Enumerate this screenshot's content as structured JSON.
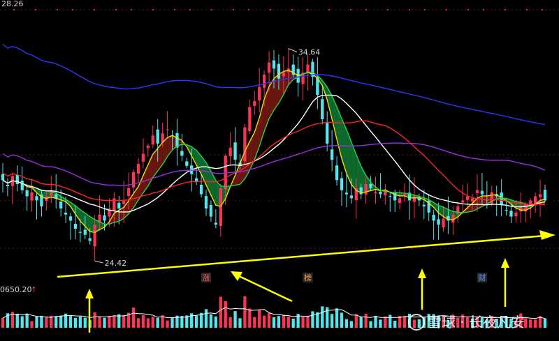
{
  "chart_data": {
    "type": "candlestick",
    "price_axis_top_label": "28.26",
    "price_range": [
      23.0,
      36.0
    ],
    "high_marker": {
      "value": "34.64",
      "index": 54
    },
    "low_marker": {
      "value": "24.42",
      "index": 18
    },
    "volume_label": "0650.20",
    "event_tags": [
      {
        "index": 42,
        "text": "涨",
        "color": "#ff5a5a"
      },
      {
        "index": 63,
        "text": "榜",
        "color": "#ff9a3a"
      },
      {
        "index": 99,
        "text": "财",
        "color": "#5aa0ff"
      }
    ],
    "watermark": "雪球 · 长夜凡安",
    "colors": {
      "up": "#ff3355",
      "down": "#54e5ef",
      "ma_fast": "#ffffff",
      "ma_yellow": "#f0e000",
      "ma_green": "#23d24a",
      "ma_red": "#ff2424",
      "ma_purple": "#9a2fe0",
      "ma_blue": "#3333ff",
      "trend_line": "#ffff00",
      "arrow": "#ffff00"
    },
    "closes": [
      27.6,
      27.3,
      27.8,
      27.4,
      27.1,
      26.8,
      27.0,
      26.6,
      26.3,
      26.8,
      27.1,
      26.7,
      26.2,
      25.9,
      25.6,
      25.2,
      25.0,
      24.9,
      24.6,
      25.4,
      25.9,
      25.6,
      26.2,
      26.7,
      26.2,
      26.6,
      27.2,
      28.0,
      28.4,
      28.9,
      29.3,
      29.8,
      29.4,
      29.9,
      30.1,
      29.8,
      29.2,
      28.8,
      28.3,
      27.9,
      27.5,
      26.9,
      26.2,
      25.8,
      25.4,
      27.2,
      28.8,
      29.2,
      28.6,
      28.3,
      30.2,
      31.2,
      31.5,
      32.2,
      32.8,
      33.4,
      33.1,
      32.6,
      32.9,
      33.1,
      32.8,
      32.4,
      32.9,
      33.3,
      32.7,
      31.8,
      30.6,
      29.4,
      28.6,
      27.6,
      27.1,
      26.9,
      26.7,
      27.2,
      26.9,
      27.4,
      27.2,
      27.0,
      26.9,
      27.1,
      26.8,
      26.6,
      26.7,
      26.9,
      26.6,
      26.8,
      26.6,
      26.3,
      26.0,
      25.6,
      25.4,
      25.7,
      25.6,
      25.9,
      26.3,
      26.6,
      26.8,
      26.7,
      27.1,
      26.9,
      26.6,
      27.0,
      26.8,
      26.4,
      26.1,
      25.8,
      26.0,
      26.3,
      26.4,
      26.6,
      26.8,
      26.9,
      26.6
    ],
    "ma_series": [
      {
        "key": "ma_yellow",
        "period": 5
      },
      {
        "key": "ma_green",
        "period": 10
      },
      {
        "key": "ma_fast",
        "period": 20
      },
      {
        "key": "ma_red",
        "period": 30
      },
      {
        "key": "ma_purple",
        "period": 60
      },
      {
        "key": "ma_blue",
        "period": 120
      }
    ]
  }
}
